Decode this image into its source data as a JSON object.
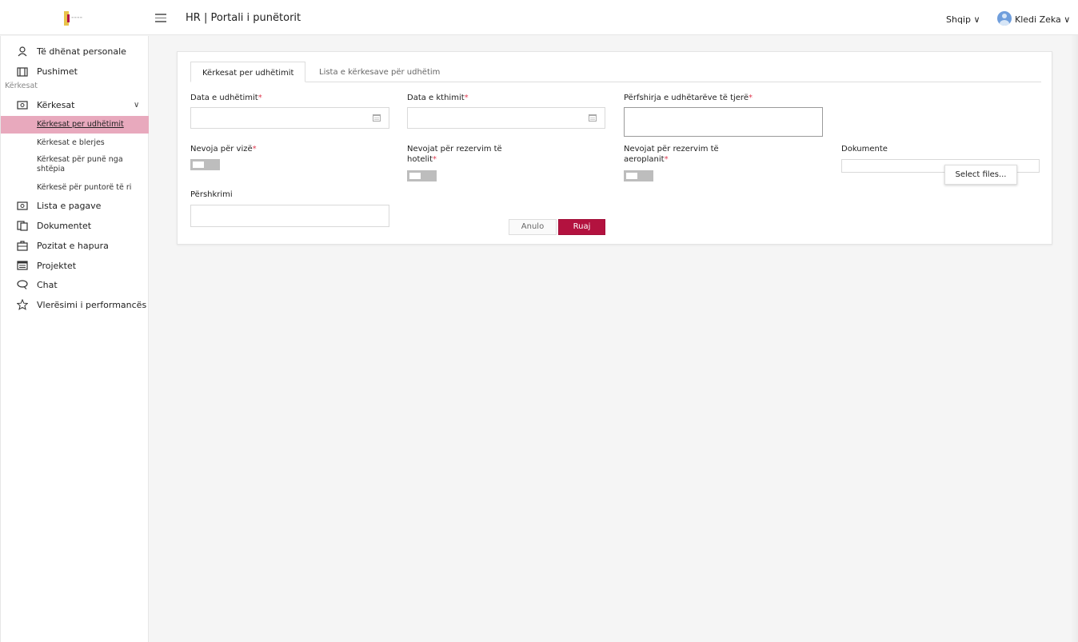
{
  "header": {
    "app_title": "HR | Portali i punëtorit",
    "language": "Shqip ∨",
    "user_name": "Kledi Zeka ∨"
  },
  "sidebar": {
    "items": [
      {
        "label": "Të dhënat personale",
        "icon": "user-icon"
      },
      {
        "label": "Pushimet",
        "icon": "suitcase-icon"
      },
      {
        "label": "Kërkesat",
        "icon": "money-icon"
      },
      {
        "label": "Lista e pagave",
        "icon": "money-icon"
      },
      {
        "label": "Dokumentet",
        "icon": "documents-icon"
      },
      {
        "label": "Pozitat e hapura",
        "icon": "briefcase-icon"
      },
      {
        "label": "Projektet",
        "icon": "projects-icon"
      },
      {
        "label": "Chat",
        "icon": "chat-icon"
      },
      {
        "label": "Vlerësimi i performancës",
        "icon": "star-icon"
      }
    ],
    "section_label": "Kërkesat",
    "submenu": [
      {
        "label": "Kërkesat per udhëtimit",
        "active": true
      },
      {
        "label": "Kërkesat e blerjes"
      },
      {
        "label": "Kërkesat për punë nga shtëpia"
      },
      {
        "label": "Kërkesë për puntorë të ri"
      }
    ],
    "active_color": "#e8a9bd"
  },
  "tabs": [
    {
      "label": "Kërkesat per udhëtimit",
      "active": true
    },
    {
      "label": "Lista e kërkesave për udhëtim",
      "active": false
    }
  ],
  "form": {
    "travel_date": {
      "label": "Data e udhëtimit",
      "value": ""
    },
    "return_date": {
      "label": "Data e kthimit",
      "value": ""
    },
    "other_travelers": {
      "label": "Përfshirja e udhëtarëve të tjerë",
      "value": ""
    },
    "visa_needed": {
      "label": "Nevoja për vizë",
      "on": false
    },
    "hotel_needed": {
      "label": "Nevojat për rezervim të hotelit",
      "on": false
    },
    "flight_needed": {
      "label": "Nevojat për rezervim të aeroplanit",
      "on": false
    },
    "documents": {
      "label": "Dokumente",
      "button": "Select files..."
    },
    "description": {
      "label": "Përshkrimi",
      "value": ""
    },
    "required_mark": "*",
    "cancel_label": "Anulo",
    "save_label": "Ruaj",
    "brand_color": "#b3123f"
  }
}
